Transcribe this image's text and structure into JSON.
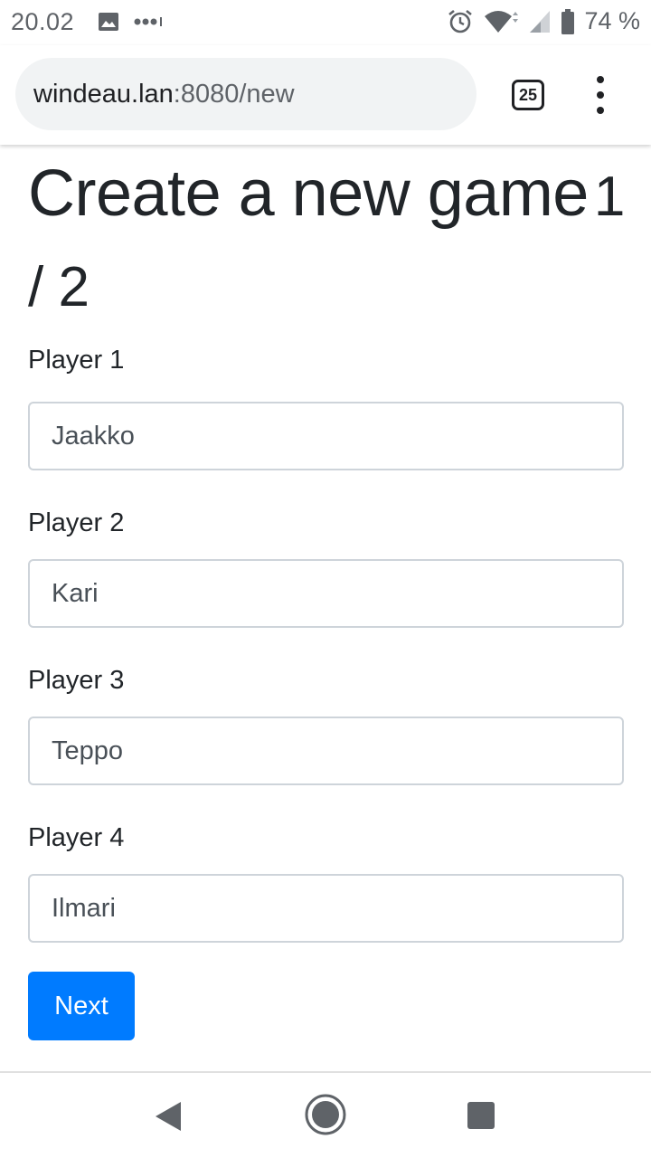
{
  "status_bar": {
    "time": "20.02",
    "battery": "74 %",
    "icons": [
      "image-icon",
      "more-dots-icon",
      "alarm-icon",
      "wifi-icon",
      "signal-icon",
      "battery-icon"
    ]
  },
  "browser": {
    "url_host": "windeau.lan",
    "url_rest": ":8080/new",
    "tab_count": "25"
  },
  "page": {
    "title": "Create a new game",
    "step": "1 / 2",
    "players": [
      {
        "label": "Player 1",
        "value": "Jaakko"
      },
      {
        "label": "Player 2",
        "value": "Kari"
      },
      {
        "label": "Player 3",
        "value": "Teppo"
      },
      {
        "label": "Player 4",
        "value": "Ilmari"
      }
    ],
    "next_label": "Next"
  },
  "nav_bar": {
    "icons": [
      "back-icon",
      "home-icon",
      "recents-icon"
    ]
  },
  "colors": {
    "primary": "#007bff",
    "text": "#212529",
    "input_border": "#ced4da"
  }
}
